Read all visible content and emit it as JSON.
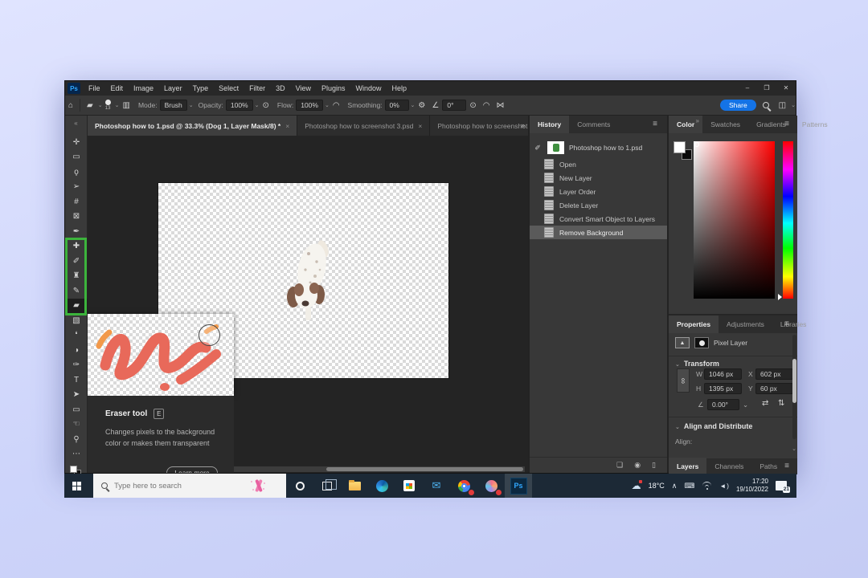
{
  "window": {
    "app": "Ps",
    "controls": {
      "minimize": "–",
      "restore": "❐",
      "close": "✕"
    }
  },
  "menu_bar": {
    "items": [
      "File",
      "Edit",
      "Image",
      "Layer",
      "Type",
      "Select",
      "Filter",
      "3D",
      "View",
      "Plugins",
      "Window",
      "Help"
    ]
  },
  "options_bar": {
    "brush_size": "13",
    "mode_label": "Mode:",
    "mode_value": "Brush",
    "opacity_label": "Opacity:",
    "opacity_value": "100%",
    "flow_label": "Flow:",
    "flow_value": "100%",
    "smoothing_label": "Smoothing:",
    "smoothing_value": "0%",
    "angle_value": "0°",
    "share_label": "Share"
  },
  "doc_tabs": {
    "tabs": [
      {
        "label": "Photoshop how to 1.psd @ 33.3% (Dog 1, Layer Mask/8) *",
        "close": "×",
        "cls": "active"
      },
      {
        "label": "Photoshop how to screenshot 3.psd",
        "close": "×",
        "cls": ""
      },
      {
        "label": "Photoshop how to screenshot",
        "close": "",
        "cls": ""
      }
    ],
    "overflow": "»"
  },
  "toolbar": {
    "collapse": "«",
    "tools": [
      {
        "name": "move-tool",
        "glyph": "✛",
        "cls": ""
      },
      {
        "name": "marquee-tool",
        "glyph": "▭",
        "cls": ""
      },
      {
        "name": "lasso-tool",
        "glyph": "ϙ",
        "cls": ""
      },
      {
        "name": "object-selection-tool",
        "glyph": "➢",
        "cls": ""
      },
      {
        "name": "crop-tool",
        "glyph": "#",
        "cls": ""
      },
      {
        "name": "frame-tool",
        "glyph": "⊠",
        "cls": ""
      },
      {
        "name": "eyedropper-tool",
        "glyph": "✒",
        "cls": ""
      },
      {
        "name": "spot-healing-tool",
        "glyph": "✚",
        "cls": ""
      },
      {
        "name": "brush-tool",
        "glyph": "✐",
        "cls": ""
      },
      {
        "name": "clone-stamp-tool",
        "glyph": "♜",
        "cls": ""
      },
      {
        "name": "history-brush-tool",
        "glyph": "✎",
        "cls": ""
      },
      {
        "name": "eraser-tool",
        "glyph": "▰",
        "cls": "active"
      },
      {
        "name": "gradient-tool",
        "glyph": "▧",
        "cls": ""
      },
      {
        "name": "blur-tool",
        "glyph": "❛",
        "cls": ""
      },
      {
        "name": "dodge-tool",
        "glyph": "◑",
        "cls": ""
      },
      {
        "name": "pen-tool",
        "glyph": "✑",
        "cls": ""
      },
      {
        "name": "type-tool",
        "glyph": "T",
        "cls": ""
      },
      {
        "name": "path-select-tool",
        "glyph": "➤",
        "cls": ""
      },
      {
        "name": "shape-tool",
        "glyph": "▭",
        "cls": ""
      },
      {
        "name": "hand-tool",
        "glyph": "☜",
        "cls": ""
      },
      {
        "name": "zoom-tool",
        "glyph": "⚲",
        "cls": ""
      },
      {
        "name": "more-tools",
        "glyph": "⋯",
        "cls": ""
      }
    ]
  },
  "history_panel": {
    "tabs": [
      {
        "label": "History",
        "cls": "active"
      },
      {
        "label": "Comments",
        "cls": ""
      }
    ],
    "snapshot": "Photoshop how to 1.psd",
    "items": [
      {
        "label": "Open",
        "cls": ""
      },
      {
        "label": "New Layer",
        "cls": ""
      },
      {
        "label": "Layer Order",
        "cls": ""
      },
      {
        "label": "Delete Layer",
        "cls": ""
      },
      {
        "label": "Convert Smart Object to Layers",
        "cls": ""
      },
      {
        "label": "Remove Background",
        "cls": "selected"
      }
    ]
  },
  "color_panel": {
    "tabs": [
      {
        "label": "Color",
        "cls": "active"
      },
      {
        "label": "Swatches",
        "cls": ""
      },
      {
        "label": "Gradients",
        "cls": ""
      },
      {
        "label": "Patterns",
        "cls": ""
      }
    ]
  },
  "properties_panel": {
    "tabs": [
      {
        "label": "Properties",
        "cls": "active"
      },
      {
        "label": "Adjustments",
        "cls": ""
      },
      {
        "label": "Libraries",
        "cls": ""
      }
    ],
    "layer_type": "Pixel Layer",
    "transform": {
      "title": "Transform",
      "w_label": "W",
      "w_value": "1046 px",
      "x_label": "X",
      "x_value": "602 px",
      "h_label": "H",
      "h_value": "1395 px",
      "y_label": "Y",
      "y_value": "60 px",
      "angle_value": "0.00°"
    },
    "align": {
      "title": "Align and Distribute",
      "align_label": "Align:"
    }
  },
  "bottom_tabs": {
    "tabs": [
      {
        "label": "Layers",
        "cls": "active"
      },
      {
        "label": "Channels",
        "cls": ""
      },
      {
        "label": "Paths",
        "cls": ""
      }
    ]
  },
  "tooltip": {
    "title": "Eraser tool",
    "shortcut": "E",
    "description": "Changes pixels to the background color or makes them transparent",
    "button": "Learn more"
  },
  "taskbar": {
    "search_placeholder": "Type here to search",
    "temperature": "18°C",
    "time": "17:20",
    "date": "19/10/2022",
    "notification_count": "21"
  },
  "icons": {
    "home": "⌂",
    "dropdown": "⌄",
    "hamburger": "≡",
    "collapse_left": "«",
    "collapse_right": "»",
    "gear": "⚙",
    "angle": "∠",
    "pressure": "⊙",
    "airbrush": "◠",
    "symmetry": "⋈",
    "toggle_panel": "▥",
    "workspace": "◫",
    "eraser_preview": "▰",
    "brush_source": "✐",
    "flip_h": "⇄",
    "flip_v": "⇅",
    "link": "∞",
    "new_doc_state": "❏",
    "snapshot_camera": "◉",
    "delete_state": "▯",
    "keyboard": "⌨",
    "cloud": "☁",
    "chevron_up": "∧",
    "image_thumb": "▲"
  },
  "colors": {
    "accent_blue": "#1473e6",
    "highlight_green": "#3cb43c",
    "squiggle_coral": "#e8695a",
    "squiggle_orange": "#f2994a",
    "taskbar_bg": "#1c2936"
  }
}
